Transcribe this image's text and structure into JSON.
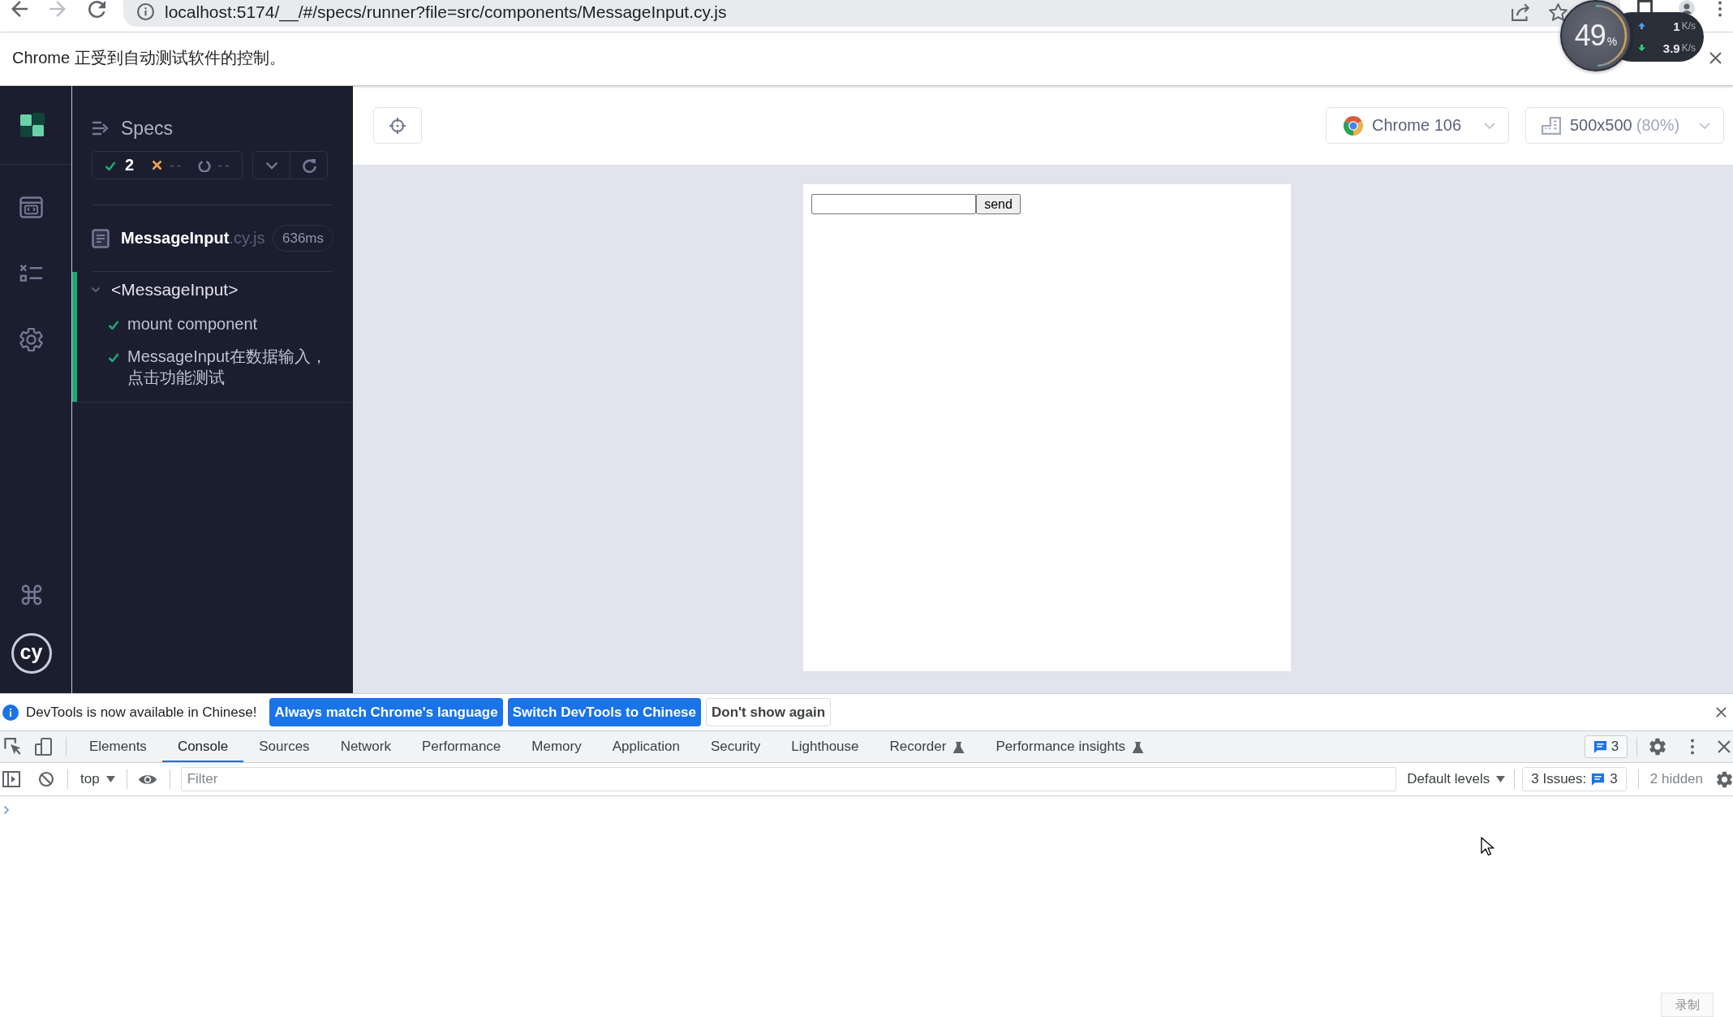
{
  "browser": {
    "url": "localhost:5174/__/#/specs/runner?file=src/components/MessageInput.cy.js"
  },
  "automation_notice": {
    "message": "Chrome 正受到自动测试软件的控制。"
  },
  "speed_widget": {
    "cpu": "49",
    "cpu_unit": "%",
    "level": 0.49,
    "upload": "1",
    "upload_unit": "K/s",
    "download": "3.9",
    "download_unit": "K/s"
  },
  "cypress": {
    "logo_text": "cy",
    "specs_panel": {
      "title": "Specs",
      "passed": "2",
      "failed": "--",
      "pending": "--",
      "file": {
        "name": "MessageInput",
        "extension": ".cy.js",
        "duration": "636ms"
      },
      "suite": {
        "title": "<MessageInput>",
        "passed": true,
        "expanded": true,
        "tests": [
          {
            "title": "mount component",
            "passed": true
          },
          {
            "title": "MessageInput在数据输入，点击功能测试",
            "passed": true
          }
        ]
      }
    },
    "toolbar": {
      "browser": "Chrome 106",
      "viewport": "500x500",
      "scale": "(80%)"
    },
    "preview": {
      "button": "send"
    }
  },
  "devtools": {
    "notice": {
      "message": "DevTools is now available in Chinese!",
      "buttons": [
        {
          "label": "Always match Chrome's language",
          "kind": "primary"
        },
        {
          "label": "Switch DevTools to Chinese",
          "kind": "primary"
        },
        {
          "label": "Don't show again",
          "kind": "secondary"
        }
      ]
    },
    "tabs": [
      {
        "label": "Elements",
        "selected": false,
        "experimental": false
      },
      {
        "label": "Console",
        "selected": true,
        "experimental": false
      },
      {
        "label": "Sources",
        "selected": false,
        "experimental": false
      },
      {
        "label": "Network",
        "selected": false,
        "experimental": false
      },
      {
        "label": "Performance",
        "selected": false,
        "experimental": false
      },
      {
        "label": "Memory",
        "selected": false,
        "experimental": false
      },
      {
        "label": "Application",
        "selected": false,
        "experimental": false
      },
      {
        "label": "Security",
        "selected": false,
        "experimental": false
      },
      {
        "label": "Lighthouse",
        "selected": false,
        "experimental": false
      },
      {
        "label": "Recorder",
        "selected": false,
        "experimental": true
      },
      {
        "label": "Performance insights",
        "selected": false,
        "experimental": true
      }
    ],
    "issues_count": "3",
    "console_toolbar": {
      "context": "top",
      "filter": {
        "placeholder": "Filter"
      },
      "levels": "Default levels",
      "issues_label": "3 Issues:",
      "issues_count": "3",
      "hidden": "2 hidden"
    },
    "corner_button": {
      "label": "录制"
    }
  }
}
